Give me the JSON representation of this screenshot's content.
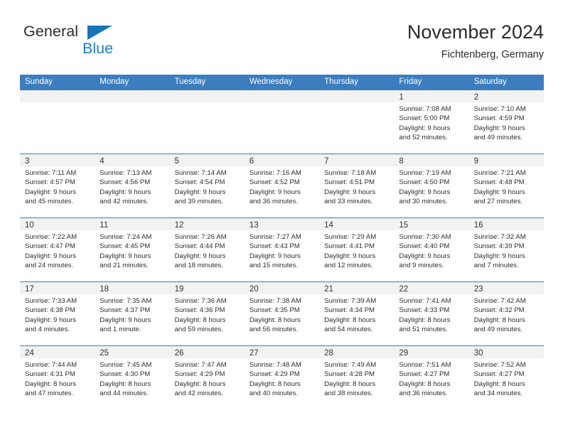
{
  "brand": {
    "name_top": "General",
    "name_bottom": "Blue",
    "triangle_color": "#1a73b7",
    "blue_color": "#1a7fd4"
  },
  "header": {
    "title": "November 2024",
    "subtitle": "Fichtenberg, Germany"
  },
  "theme": {
    "header_blue": "#3b7dbf",
    "daynum_band": "#f2f2f2",
    "text": "#2e2e2e"
  },
  "weekdays": [
    "Sunday",
    "Monday",
    "Tuesday",
    "Wednesday",
    "Thursday",
    "Friday",
    "Saturday"
  ],
  "weeks": [
    [
      {
        "day": "",
        "sunrise": "",
        "sunset": "",
        "daylight_a": "",
        "daylight_b": ""
      },
      {
        "day": "",
        "sunrise": "",
        "sunset": "",
        "daylight_a": "",
        "daylight_b": ""
      },
      {
        "day": "",
        "sunrise": "",
        "sunset": "",
        "daylight_a": "",
        "daylight_b": ""
      },
      {
        "day": "",
        "sunrise": "",
        "sunset": "",
        "daylight_a": "",
        "daylight_b": ""
      },
      {
        "day": "",
        "sunrise": "",
        "sunset": "",
        "daylight_a": "",
        "daylight_b": ""
      },
      {
        "day": "1",
        "sunrise": "Sunrise: 7:08 AM",
        "sunset": "Sunset: 5:00 PM",
        "daylight_a": "Daylight: 9 hours",
        "daylight_b": "and 52 minutes."
      },
      {
        "day": "2",
        "sunrise": "Sunrise: 7:10 AM",
        "sunset": "Sunset: 4:59 PM",
        "daylight_a": "Daylight: 9 hours",
        "daylight_b": "and 49 minutes."
      }
    ],
    [
      {
        "day": "3",
        "sunrise": "Sunrise: 7:11 AM",
        "sunset": "Sunset: 4:57 PM",
        "daylight_a": "Daylight: 9 hours",
        "daylight_b": "and 45 minutes."
      },
      {
        "day": "4",
        "sunrise": "Sunrise: 7:13 AM",
        "sunset": "Sunset: 4:56 PM",
        "daylight_a": "Daylight: 9 hours",
        "daylight_b": "and 42 minutes."
      },
      {
        "day": "5",
        "sunrise": "Sunrise: 7:14 AM",
        "sunset": "Sunset: 4:54 PM",
        "daylight_a": "Daylight: 9 hours",
        "daylight_b": "and 39 minutes."
      },
      {
        "day": "6",
        "sunrise": "Sunrise: 7:16 AM",
        "sunset": "Sunset: 4:52 PM",
        "daylight_a": "Daylight: 9 hours",
        "daylight_b": "and 36 minutes."
      },
      {
        "day": "7",
        "sunrise": "Sunrise: 7:18 AM",
        "sunset": "Sunset: 4:51 PM",
        "daylight_a": "Daylight: 9 hours",
        "daylight_b": "and 33 minutes."
      },
      {
        "day": "8",
        "sunrise": "Sunrise: 7:19 AM",
        "sunset": "Sunset: 4:50 PM",
        "daylight_a": "Daylight: 9 hours",
        "daylight_b": "and 30 minutes."
      },
      {
        "day": "9",
        "sunrise": "Sunrise: 7:21 AM",
        "sunset": "Sunset: 4:48 PM",
        "daylight_a": "Daylight: 9 hours",
        "daylight_b": "and 27 minutes."
      }
    ],
    [
      {
        "day": "10",
        "sunrise": "Sunrise: 7:22 AM",
        "sunset": "Sunset: 4:47 PM",
        "daylight_a": "Daylight: 9 hours",
        "daylight_b": "and 24 minutes."
      },
      {
        "day": "11",
        "sunrise": "Sunrise: 7:24 AM",
        "sunset": "Sunset: 4:45 PM",
        "daylight_a": "Daylight: 9 hours",
        "daylight_b": "and 21 minutes."
      },
      {
        "day": "12",
        "sunrise": "Sunrise: 7:26 AM",
        "sunset": "Sunset: 4:44 PM",
        "daylight_a": "Daylight: 9 hours",
        "daylight_b": "and 18 minutes."
      },
      {
        "day": "13",
        "sunrise": "Sunrise: 7:27 AM",
        "sunset": "Sunset: 4:43 PM",
        "daylight_a": "Daylight: 9 hours",
        "daylight_b": "and 15 minutes."
      },
      {
        "day": "14",
        "sunrise": "Sunrise: 7:29 AM",
        "sunset": "Sunset: 4:41 PM",
        "daylight_a": "Daylight: 9 hours",
        "daylight_b": "and 12 minutes."
      },
      {
        "day": "15",
        "sunrise": "Sunrise: 7:30 AM",
        "sunset": "Sunset: 4:40 PM",
        "daylight_a": "Daylight: 9 hours",
        "daylight_b": "and 9 minutes."
      },
      {
        "day": "16",
        "sunrise": "Sunrise: 7:32 AM",
        "sunset": "Sunset: 4:39 PM",
        "daylight_a": "Daylight: 9 hours",
        "daylight_b": "and 7 minutes."
      }
    ],
    [
      {
        "day": "17",
        "sunrise": "Sunrise: 7:33 AM",
        "sunset": "Sunset: 4:38 PM",
        "daylight_a": "Daylight: 9 hours",
        "daylight_b": "and 4 minutes."
      },
      {
        "day": "18",
        "sunrise": "Sunrise: 7:35 AM",
        "sunset": "Sunset: 4:37 PM",
        "daylight_a": "Daylight: 9 hours",
        "daylight_b": "and 1 minute."
      },
      {
        "day": "19",
        "sunrise": "Sunrise: 7:36 AM",
        "sunset": "Sunset: 4:36 PM",
        "daylight_a": "Daylight: 8 hours",
        "daylight_b": "and 59 minutes."
      },
      {
        "day": "20",
        "sunrise": "Sunrise: 7:38 AM",
        "sunset": "Sunset: 4:35 PM",
        "daylight_a": "Daylight: 8 hours",
        "daylight_b": "and 56 minutes."
      },
      {
        "day": "21",
        "sunrise": "Sunrise: 7:39 AM",
        "sunset": "Sunset: 4:34 PM",
        "daylight_a": "Daylight: 8 hours",
        "daylight_b": "and 54 minutes."
      },
      {
        "day": "22",
        "sunrise": "Sunrise: 7:41 AM",
        "sunset": "Sunset: 4:33 PM",
        "daylight_a": "Daylight: 8 hours",
        "daylight_b": "and 51 minutes."
      },
      {
        "day": "23",
        "sunrise": "Sunrise: 7:42 AM",
        "sunset": "Sunset: 4:32 PM",
        "daylight_a": "Daylight: 8 hours",
        "daylight_b": "and 49 minutes."
      }
    ],
    [
      {
        "day": "24",
        "sunrise": "Sunrise: 7:44 AM",
        "sunset": "Sunset: 4:31 PM",
        "daylight_a": "Daylight: 8 hours",
        "daylight_b": "and 47 minutes."
      },
      {
        "day": "25",
        "sunrise": "Sunrise: 7:45 AM",
        "sunset": "Sunset: 4:30 PM",
        "daylight_a": "Daylight: 8 hours",
        "daylight_b": "and 44 minutes."
      },
      {
        "day": "26",
        "sunrise": "Sunrise: 7:47 AM",
        "sunset": "Sunset: 4:29 PM",
        "daylight_a": "Daylight: 8 hours",
        "daylight_b": "and 42 minutes."
      },
      {
        "day": "27",
        "sunrise": "Sunrise: 7:48 AM",
        "sunset": "Sunset: 4:29 PM",
        "daylight_a": "Daylight: 8 hours",
        "daylight_b": "and 40 minutes."
      },
      {
        "day": "28",
        "sunrise": "Sunrise: 7:49 AM",
        "sunset": "Sunset: 4:28 PM",
        "daylight_a": "Daylight: 8 hours",
        "daylight_b": "and 38 minutes."
      },
      {
        "day": "29",
        "sunrise": "Sunrise: 7:51 AM",
        "sunset": "Sunset: 4:27 PM",
        "daylight_a": "Daylight: 8 hours",
        "daylight_b": "and 36 minutes."
      },
      {
        "day": "30",
        "sunrise": "Sunrise: 7:52 AM",
        "sunset": "Sunset: 4:27 PM",
        "daylight_a": "Daylight: 8 hours",
        "daylight_b": "and 34 minutes."
      }
    ]
  ]
}
